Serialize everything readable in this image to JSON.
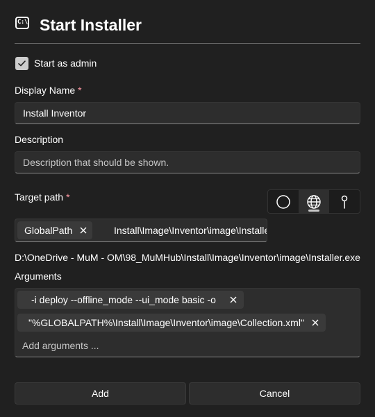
{
  "header": {
    "icon": "command-prompt-icon",
    "icon_text": "C:\\",
    "title": "Start Installer"
  },
  "admin": {
    "label": "Start as admin",
    "checked": true
  },
  "display_name": {
    "label": "Display Name",
    "required": "*",
    "value": "Install Inventor"
  },
  "description": {
    "label": "Description",
    "placeholder": "Description that should be shown."
  },
  "target_path": {
    "label": "Target path",
    "required": "*",
    "modes": [
      {
        "icon": "circle-icon",
        "selected": false
      },
      {
        "icon": "globe-icon",
        "selected": true
      },
      {
        "icon": "pin-icon",
        "selected": false
      }
    ],
    "token": "GlobalPath",
    "value": "Install\\Image\\Inventor\\image\\Installer.exe",
    "resolved": "D:\\OneDrive - MuM - OM\\98_MuMHub\\Install\\Image\\Inventor\\image\\Installer.exe"
  },
  "arguments": {
    "label": "Arguments",
    "tokens": [
      "-i deploy --offline_mode --ui_mode basic -o",
      "\"%GLOBALPATH%\\Install\\Image\\Inventor\\image\\Collection.xml\""
    ],
    "placeholder": "Add arguments ..."
  },
  "actions": {
    "add": "Add",
    "cancel": "Cancel"
  }
}
